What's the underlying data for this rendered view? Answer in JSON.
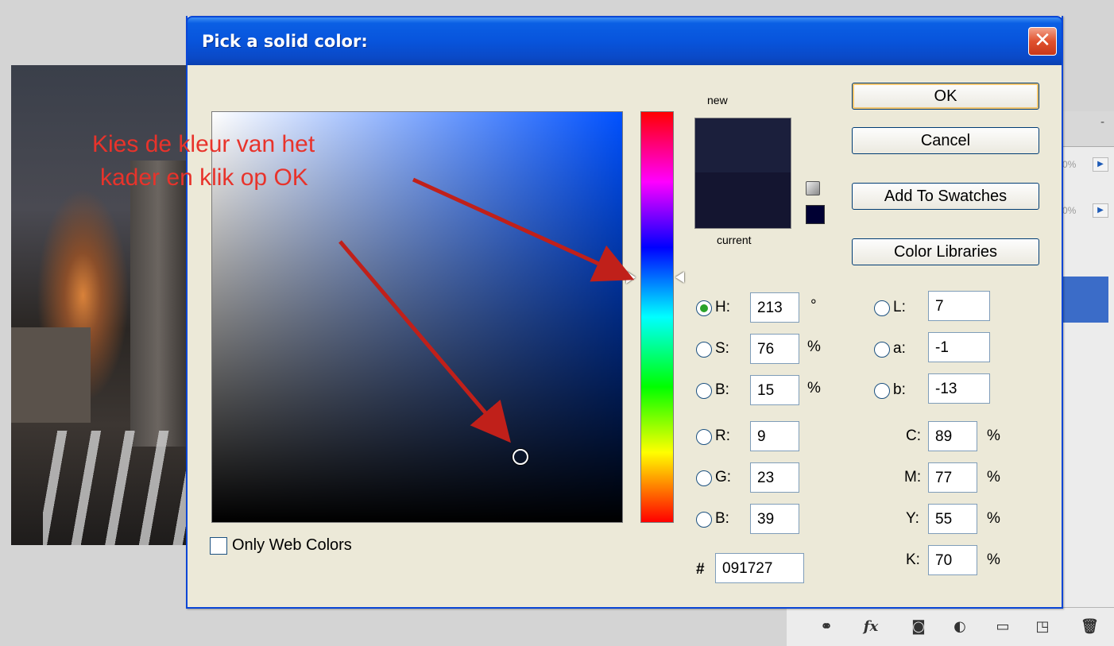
{
  "dialog": {
    "title": "Pick a solid color:",
    "close_label": "✕"
  },
  "annotation": {
    "line1": "Kies de kleur van het",
    "line2": "kader en klik op OK",
    "color": "#e8332b"
  },
  "preview": {
    "new_label": "new",
    "current_label": "current",
    "new_color": "#1b1f3c",
    "current_color": "#141530"
  },
  "buttons": {
    "ok": "OK",
    "cancel": "Cancel",
    "add_to_swatches": "Add To Swatches",
    "color_libraries": "Color Libraries"
  },
  "hsb": {
    "h_label": "H:",
    "h_value": "213",
    "h_unit": "°",
    "s_label": "S:",
    "s_value": "76",
    "s_unit": "%",
    "b_label": "B:",
    "b_value": "15",
    "b_unit": "%"
  },
  "rgb": {
    "r_label": "R:",
    "r_value": "9",
    "g_label": "G:",
    "g_value": "23",
    "b_label": "B:",
    "b_value": "39"
  },
  "lab": {
    "l_label": "L:",
    "l_value": "7",
    "a_label": "a:",
    "a_value": "-1",
    "b_label": "b:",
    "b_value": "-13"
  },
  "cmyk": {
    "c_label": "C:",
    "c_value": "89",
    "c_unit": "%",
    "m_label": "M:",
    "m_value": "77",
    "m_unit": "%",
    "y_label": "Y:",
    "y_value": "55",
    "y_unit": "%",
    "k_label": "K:",
    "k_value": "70",
    "k_unit": "%"
  },
  "hex": {
    "label": "#",
    "value": "091727"
  },
  "only_web_colors": {
    "label": "Only Web Colors",
    "checked": false
  },
  "right_panel": {
    "pct1": "0%",
    "pct2": "0%",
    "dash": "-"
  },
  "colors": {
    "titlebar": "#0854dc",
    "dialog_bg": "#ece9d8",
    "selection": "#3b6cc8"
  }
}
